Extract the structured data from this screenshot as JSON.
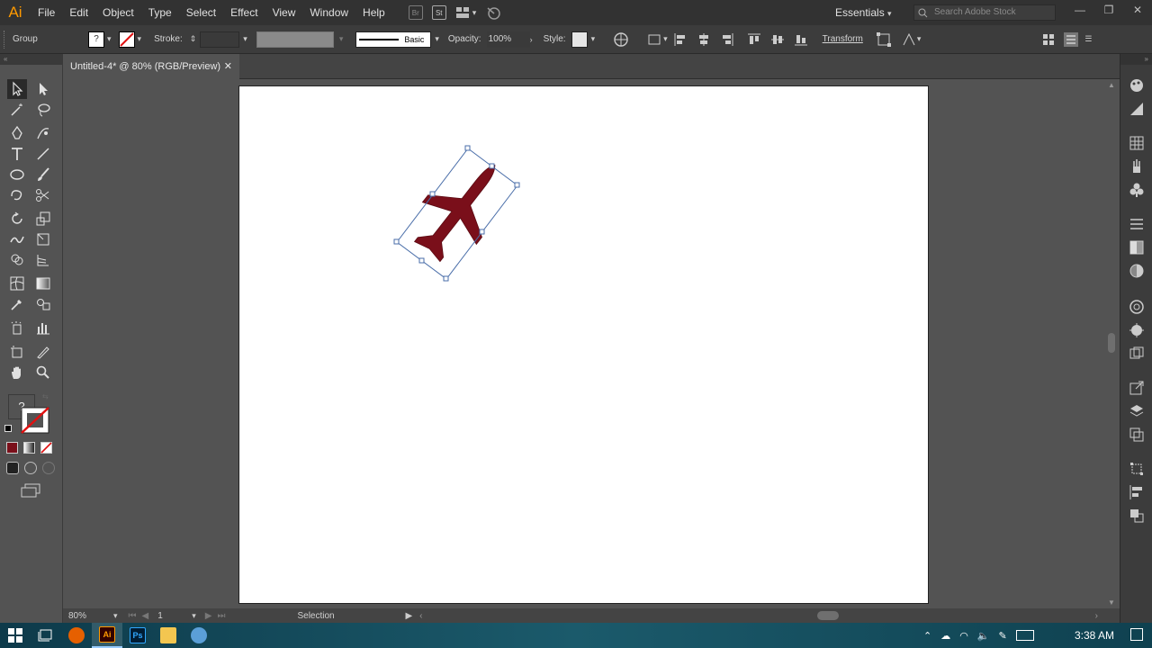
{
  "menu": {
    "logo": "Ai",
    "items": [
      "File",
      "Edit",
      "Object",
      "Type",
      "Select",
      "Effect",
      "View",
      "Window",
      "Help"
    ],
    "bridge_icon": "Br",
    "stock_icon": "St",
    "workspace": "Essentials",
    "search_placeholder": "Search Adobe Stock"
  },
  "control": {
    "selection_type": "Group",
    "fill_value": "?",
    "stroke_label": "Stroke:",
    "brush_label": "Basic",
    "opacity_label": "Opacity:",
    "opacity_value": "100%",
    "style_label": "Style:",
    "transform_label": "Transform"
  },
  "document": {
    "tab_title": "Untitled-4* @ 80% (RGB/Preview)",
    "close_glyph": "✕"
  },
  "toolbox": {
    "fill_unknown": "?"
  },
  "status": {
    "zoom": "80%",
    "artboard_number": "1",
    "current_tool": "Selection"
  },
  "taskbar": {
    "time": "3:38 AM",
    "app_ai": "Ai",
    "app_ps": "Ps"
  },
  "colors": {
    "airplane_fill": "#7a0f1a",
    "selection_blue": "#4a6ea9",
    "app_accent": "#ff9a00"
  }
}
